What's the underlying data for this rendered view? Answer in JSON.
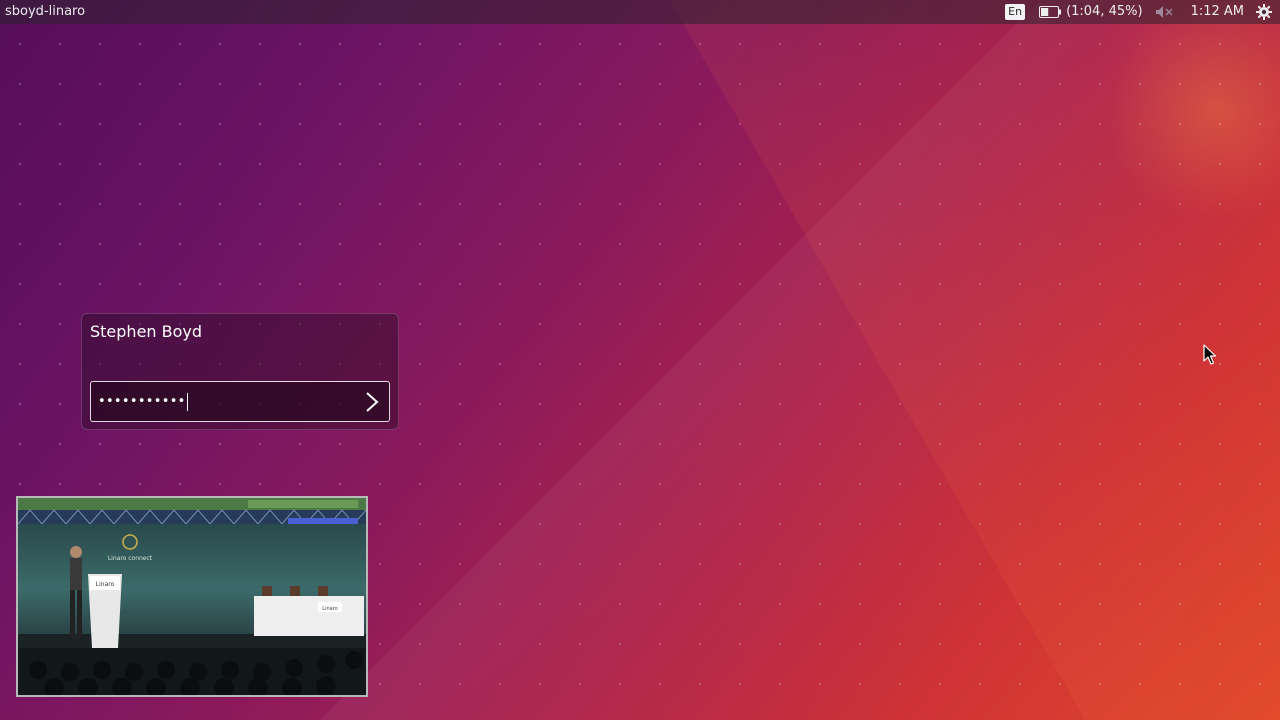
{
  "panel": {
    "hostname": "sboyd-linaro",
    "keyboard_layout": "En",
    "battery_status": "(1:04, 45%)",
    "battery_percent": 45,
    "sound_icon": "speaker-muted-icon",
    "clock": "1:12 AM",
    "settings_icon": "gear-icon"
  },
  "login": {
    "user_name": "Stephen Boyd",
    "password_mask": "•••••••••••",
    "submit_icon": "chevron-right-icon"
  },
  "video_overlay": {
    "banner_text": "Linaro connect",
    "podium_text": "Linaro",
    "table_text": "Linaro"
  },
  "colors": {
    "wallpaper_start": "#5a1060",
    "wallpaper_mid": "#b02349",
    "wallpaper_end": "#e0492a",
    "panel_text": "#eeeeee"
  }
}
